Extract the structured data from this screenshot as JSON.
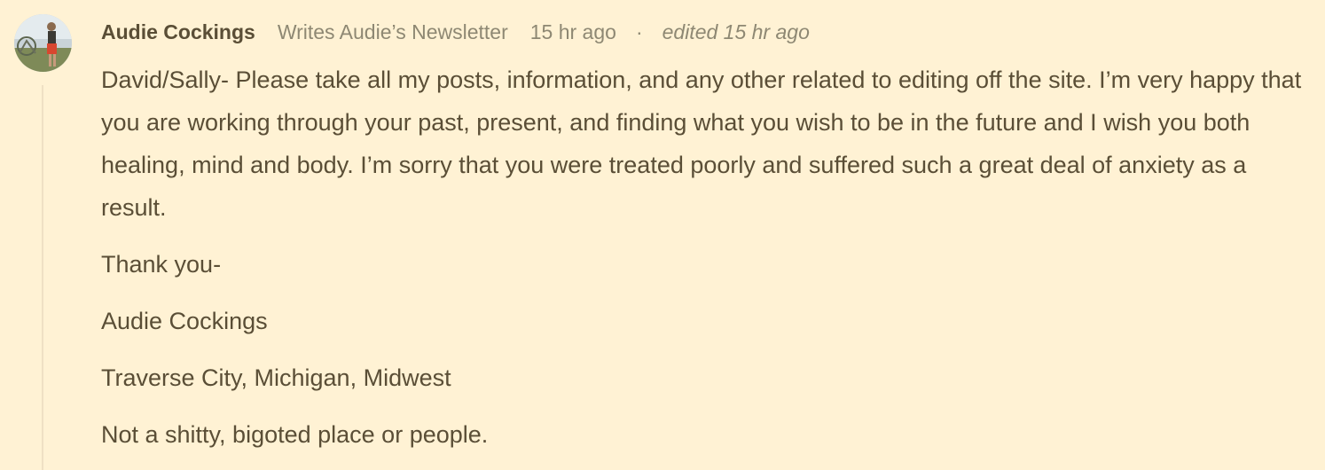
{
  "comment": {
    "author": "Audie Cockings",
    "publication": "Writes Audie’s Newsletter",
    "timestamp": "15 hr ago",
    "separator": "·",
    "edited": "edited 15 hr ago",
    "paragraphs": [
      "David/Sally- Please take all my posts, information, and any other related to editing off the site. I’m very happy that you are working through your past, present, and finding what you wish to be in the future and I wish you both healing, mind and body. I’m sorry that you were treated poorly and suffered such a great deal of anxiety as a result.",
      "Thank you-",
      "Audie Cockings",
      "Traverse City, Michigan, Midwest",
      "Not a shitty, bigoted place or people."
    ]
  },
  "colors": {
    "background": "#fff2d4",
    "text": "#5a4e36",
    "muted": "#8e8873",
    "thread_line": "#efe0c4"
  }
}
